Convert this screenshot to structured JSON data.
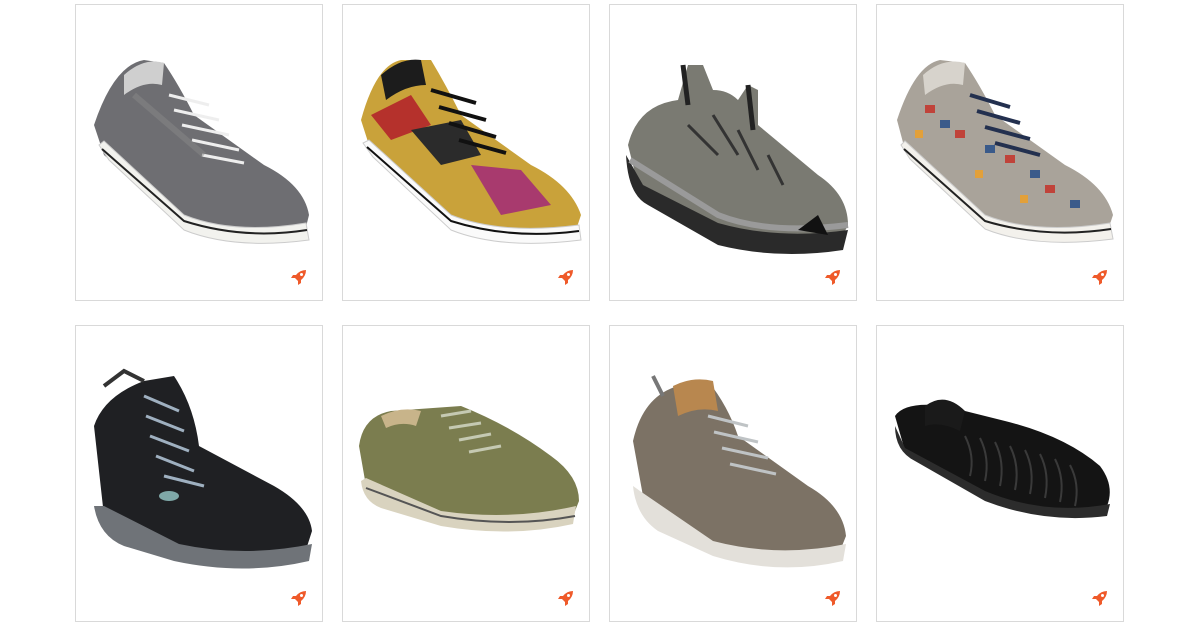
{
  "products": [
    {
      "id": "p1",
      "image": "grey-plaid-canvas-sneaker-image",
      "badge_icon": "rocket-icon",
      "accent": "#ef5a2a"
    },
    {
      "id": "p2",
      "image": "tribal-print-canvas-sneaker-image",
      "badge_icon": "rocket-icon",
      "accent": "#ef5a2a"
    },
    {
      "id": "p3",
      "image": "grey-sport-sandal-image",
      "badge_icon": "rocket-icon",
      "accent": "#ef5a2a"
    },
    {
      "id": "p4",
      "image": "houndstooth-canvas-sneaker-image",
      "badge_icon": "rocket-icon",
      "accent": "#ef5a2a"
    },
    {
      "id": "p5",
      "image": "black-hiking-boot-image",
      "badge_icon": "rocket-icon",
      "accent": "#ef5a2a"
    },
    {
      "id": "p6",
      "image": "olive-leather-sneaker-image",
      "badge_icon": "rocket-icon",
      "accent": "#ef5a2a"
    },
    {
      "id": "p7",
      "image": "taupe-suede-sneaker-image",
      "badge_icon": "rocket-icon",
      "accent": "#ef5a2a"
    },
    {
      "id": "p8",
      "image": "black-cord-slide-image",
      "badge_icon": "rocket-icon",
      "accent": "#ef5a2a"
    }
  ]
}
